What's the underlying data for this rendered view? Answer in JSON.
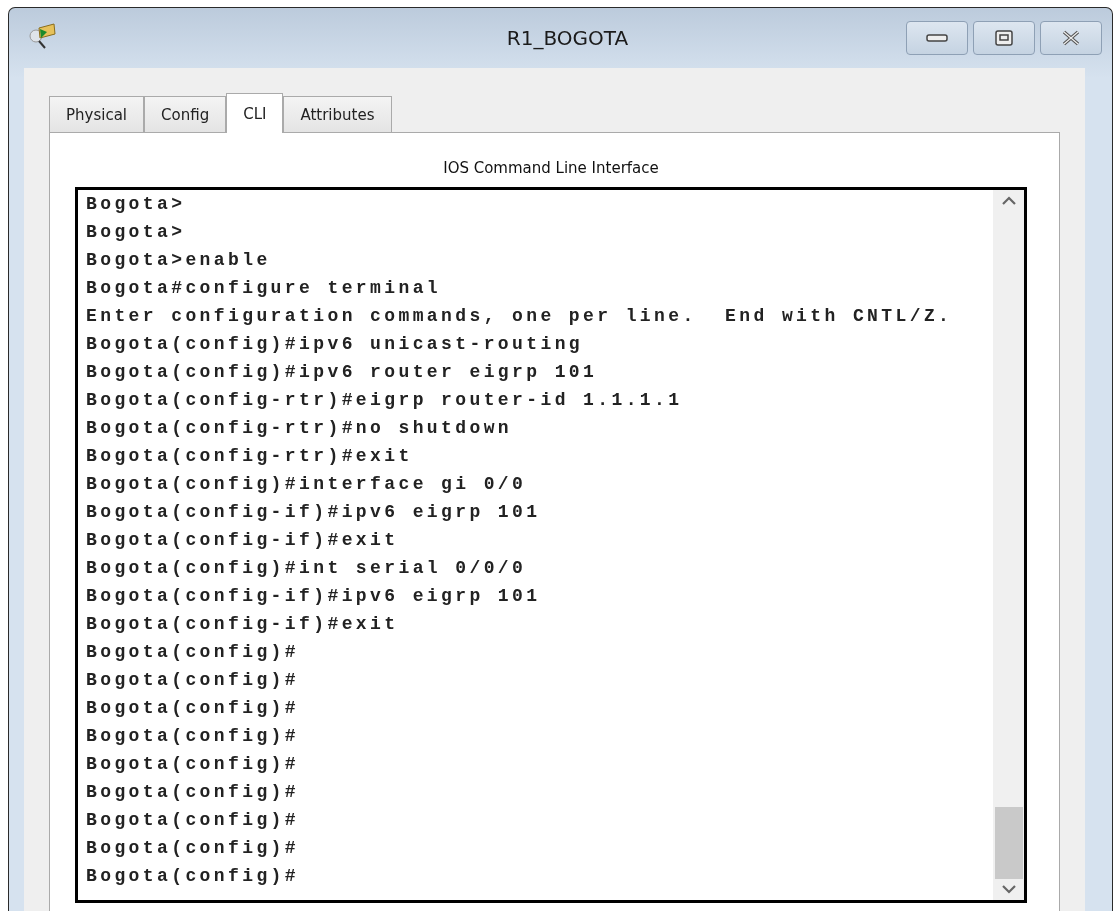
{
  "window": {
    "title": "R1_BOGOTA"
  },
  "tabs": [
    {
      "label": "Physical",
      "selected": false
    },
    {
      "label": "Config",
      "selected": false
    },
    {
      "label": "CLI",
      "selected": true
    },
    {
      "label": "Attributes",
      "selected": false
    }
  ],
  "panel_title": "IOS Command Line Interface",
  "terminal_lines": [
    "Bogota>",
    "Bogota>",
    "Bogota>enable",
    "Bogota#configure terminal",
    "Enter configuration commands, one per line.  End with CNTL/Z.",
    "Bogota(config)#ipv6 unicast-routing",
    "Bogota(config)#ipv6 router eigrp 101",
    "Bogota(config-rtr)#eigrp router-id 1.1.1.1",
    "Bogota(config-rtr)#no shutdown",
    "Bogota(config-rtr)#exit",
    "Bogota(config)#interface gi 0/0",
    "Bogota(config-if)#ipv6 eigrp 101",
    "Bogota(config-if)#exit",
    "Bogota(config)#int serial 0/0/0",
    "Bogota(config-if)#ipv6 eigrp 101",
    "Bogota(config-if)#exit",
    "Bogota(config)#",
    "Bogota(config)#",
    "Bogota(config)#",
    "Bogota(config)#",
    "Bogota(config)#",
    "Bogota(config)#",
    "Bogota(config)#",
    "Bogota(config)#",
    "Bogota(config)#"
  ]
}
